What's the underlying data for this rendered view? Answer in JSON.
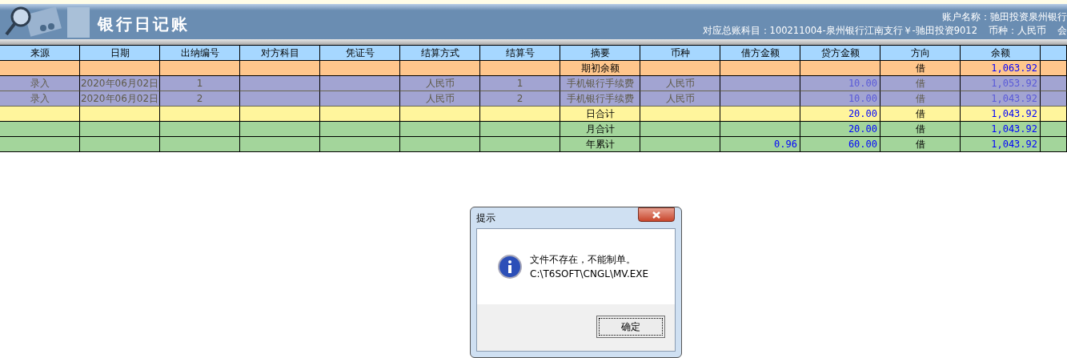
{
  "header": {
    "title": "银行日记账",
    "account": "账户名称：驰田投资泉州银行",
    "ledger": "对应总账科目：100211004-泉州银行江南支行￥-驰田投资9012",
    "currency": "币种：人民币",
    "cut": "会"
  },
  "table": {
    "columns": [
      "来源",
      "日期",
      "出纳编号",
      "对方科目",
      "凭证号",
      "结算方式",
      "结算号",
      "摘要",
      "币种",
      "借方金额",
      "贷方金额",
      "方向",
      "余额"
    ],
    "rows": [
      {
        "kind": "opening",
        "cells": [
          "",
          "",
          "",
          "",
          "",
          "",
          "",
          "期初余额",
          "",
          "",
          "",
          "借",
          "1,063.92"
        ]
      },
      {
        "kind": "entry",
        "cells": [
          "录入",
          "2020年06月02日",
          "1",
          "",
          "",
          "人民币",
          "1",
          "手机银行手续费",
          "人民币",
          "",
          "10.00",
          "借",
          "1,053.92"
        ]
      },
      {
        "kind": "entry",
        "cells": [
          "录入",
          "2020年06月02日",
          "2",
          "",
          "",
          "人民币",
          "2",
          "手机银行手续费",
          "人民币",
          "",
          "10.00",
          "借",
          "1,043.92"
        ]
      },
      {
        "kind": "day",
        "cells": [
          "",
          "",
          "",
          "",
          "",
          "",
          "",
          "日合计",
          "",
          "",
          "20.00",
          "借",
          "1,043.92"
        ]
      },
      {
        "kind": "total",
        "cells": [
          "",
          "",
          "",
          "",
          "",
          "",
          "",
          "月合计",
          "",
          "",
          "20.00",
          "借",
          "1,043.92"
        ]
      },
      {
        "kind": "total",
        "cells": [
          "",
          "",
          "",
          "",
          "",
          "",
          "",
          "年累计",
          "",
          "0.96",
          "60.00",
          "借",
          "1,043.92"
        ]
      }
    ]
  },
  "dialog": {
    "title": "提示",
    "message": "文件不存在，不能制单。",
    "path": "C:\\T6SOFT\\CNGL\\MV.EXE",
    "button": "确定"
  }
}
